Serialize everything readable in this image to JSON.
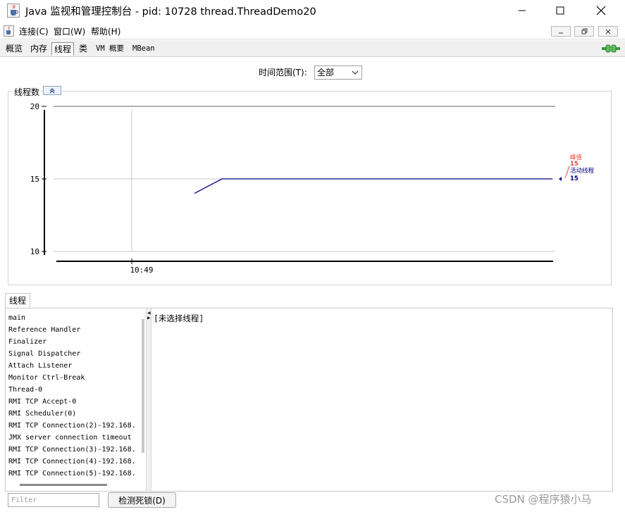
{
  "window": {
    "title": "Java 监视和管理控制台 - pid: 10728 thread.ThreadDemo20",
    "icon": "java-cup-icon"
  },
  "menu": {
    "items": [
      {
        "label": "连接(C)"
      },
      {
        "label": "窗口(W)"
      },
      {
        "label": "帮助(H)"
      }
    ]
  },
  "tabs": [
    {
      "label": "概览"
    },
    {
      "label": "内存"
    },
    {
      "label": "线程"
    },
    {
      "label": "类"
    },
    {
      "label": "VM 概要"
    },
    {
      "label": "MBean"
    }
  ],
  "active_tab": "线程",
  "time_range": {
    "label": "时间范围(T):",
    "value": "全部"
  },
  "chart_panel": {
    "title": "线程数"
  },
  "chart_data": {
    "type": "line",
    "title": "",
    "xlabel": "",
    "ylabel": "",
    "ylim": [
      10,
      20
    ],
    "yticks": [
      10,
      15,
      20
    ],
    "xticks": [
      "10:49"
    ],
    "grid": true,
    "series": [
      {
        "name": "峰值",
        "value": 15,
        "color": "#e8453c",
        "x": [
          0,
          1,
          2
        ],
        "y": [
          15,
          15,
          15
        ]
      },
      {
        "name": "活动线程",
        "value": 15,
        "color": "#000080",
        "x": [
          0,
          1,
          2
        ],
        "y": [
          14,
          15,
          15
        ]
      }
    ]
  },
  "threads_panel": {
    "tab_label": "线程",
    "list": [
      "main",
      "Reference Handler",
      "Finalizer",
      "Signal Dispatcher",
      "Attach Listener",
      "Monitor Ctrl-Break",
      "Thread-0",
      "RMI TCP Accept-0",
      "RMI Scheduler(0)",
      "RMI TCP Connection(2)-192.168.",
      "JMX server connection timeout",
      "RMI TCP Connection(3)-192.168.",
      "RMI TCP Connection(4)-192.168.",
      "RMI TCP Connection(5)-192.168."
    ],
    "detail": "[未选择线程]"
  },
  "filter": {
    "placeholder": "Filter"
  },
  "deadlock_button": {
    "label": "检测死锁(D)"
  },
  "watermark": "CSDN @程序猿小马"
}
